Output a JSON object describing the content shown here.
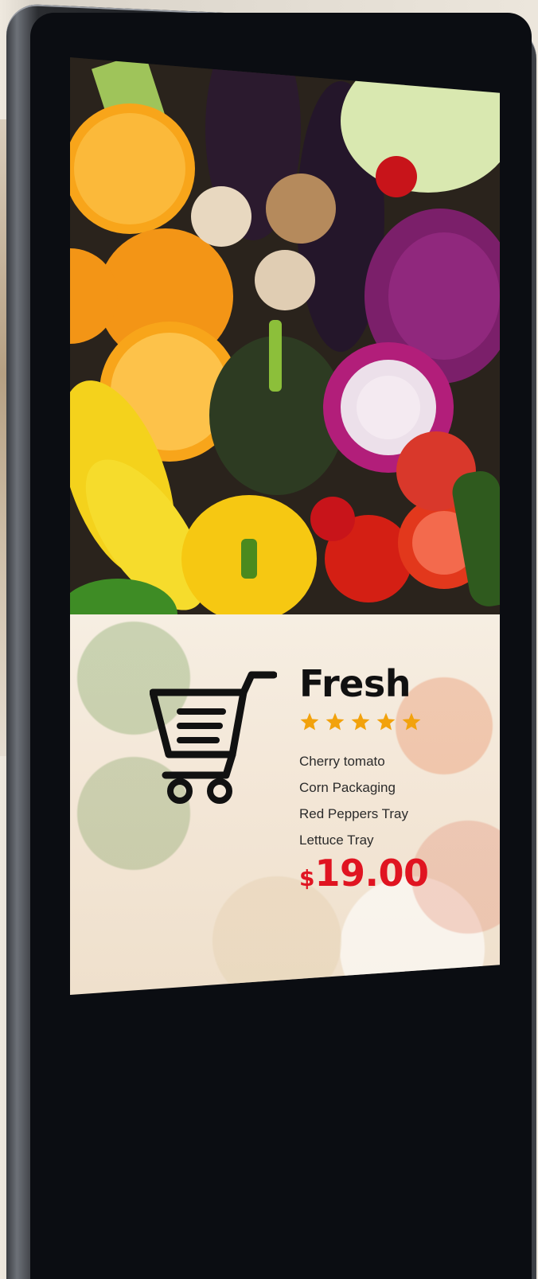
{
  "kiosk": {
    "screen": {
      "promo": {
        "title": "Fresh",
        "rating_stars": 5,
        "items": [
          "Cherry tomato",
          "Corn Packaging",
          "Red Peppers Tray",
          "Lettuce Tray"
        ],
        "price_currency": "$",
        "price_amount": "19.00",
        "icon": "shopping-cart-icon"
      }
    }
  },
  "colors": {
    "star": "#f2a20c",
    "price": "#e01421",
    "title": "#111111",
    "frame": "#16181c"
  }
}
